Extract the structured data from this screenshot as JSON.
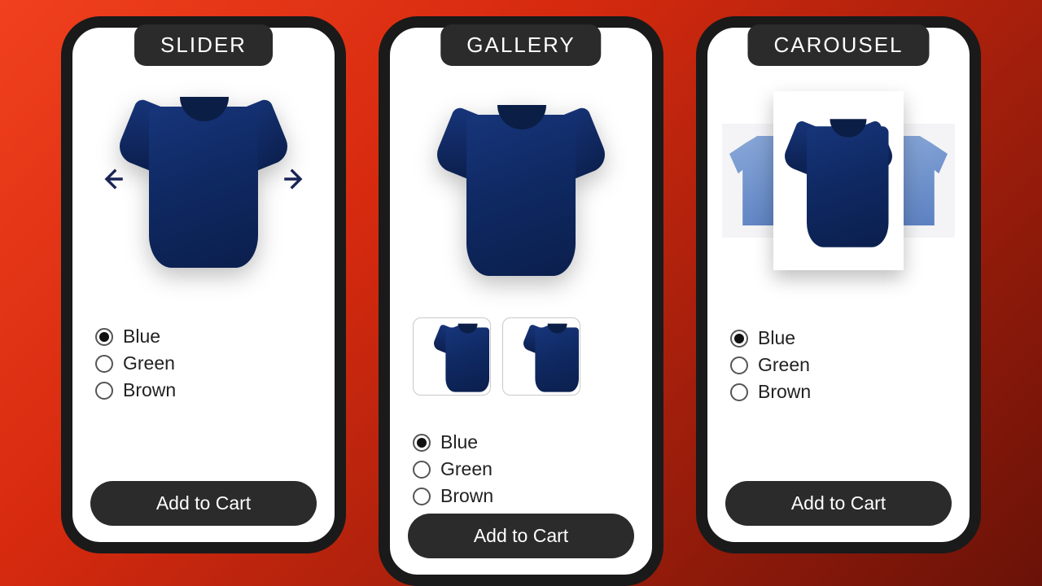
{
  "cta": "Add to Cart",
  "colors": [
    {
      "name": "Blue",
      "selected": true
    },
    {
      "name": "Green",
      "selected": false
    },
    {
      "name": "Brown",
      "selected": false
    }
  ],
  "product": {
    "name": "T-Shirt",
    "main_color": "#122d66"
  },
  "panels": {
    "slider": {
      "label": "SLIDER"
    },
    "gallery": {
      "label": "GALLERY",
      "thumbnails": 2
    },
    "carousel": {
      "label": "CAROUSEL"
    }
  }
}
